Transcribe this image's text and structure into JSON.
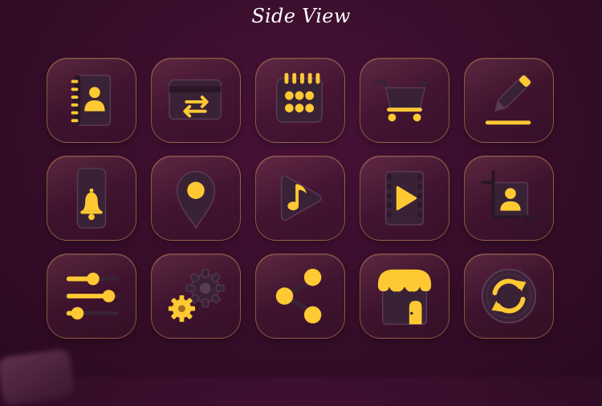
{
  "title": "Side View",
  "colors": {
    "accent": "#FFC933",
    "dark": "#3A2236",
    "background": "#3A0E2C"
  },
  "icons": [
    "contact-book-icon",
    "transfer-card-icon",
    "calendar-icon",
    "shopping-cart-icon",
    "pencil-icon",
    "phone-notification-icon",
    "location-pin-icon",
    "music-play-icon",
    "video-player-icon",
    "crop-image-icon",
    "settings-sliders-icon",
    "gears-icon",
    "share-icon",
    "store-icon",
    "refresh-icon"
  ]
}
